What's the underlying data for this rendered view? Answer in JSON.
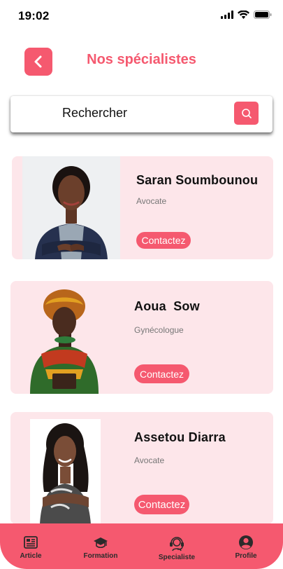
{
  "status_bar": {
    "time": "19:02"
  },
  "header": {
    "title": "Nos spécialistes"
  },
  "search": {
    "placeholder": "Rechercher"
  },
  "specialists": [
    {
      "name": "Saran Soumbounou",
      "role": "Avocate",
      "contact_label": "Contactez"
    },
    {
      "name": "Aoua  Sow",
      "role": "Gynécologue",
      "contact_label": "Contactez"
    },
    {
      "name": "Assetou Diarra",
      "role": "Avocate",
      "contact_label": "Contactez"
    }
  ],
  "bottom_nav": {
    "items": [
      {
        "label": "Article",
        "icon": "newspaper-icon"
      },
      {
        "label": "Formation",
        "icon": "graduation-cap-icon"
      },
      {
        "label": "Specialiste",
        "icon": "headset-icon"
      },
      {
        "label": "Profile",
        "icon": "user-circle-icon"
      }
    ]
  },
  "colors": {
    "accent": "#f5596f",
    "card_background": "#fde6ea",
    "nav_text": "#2b2b2b"
  }
}
